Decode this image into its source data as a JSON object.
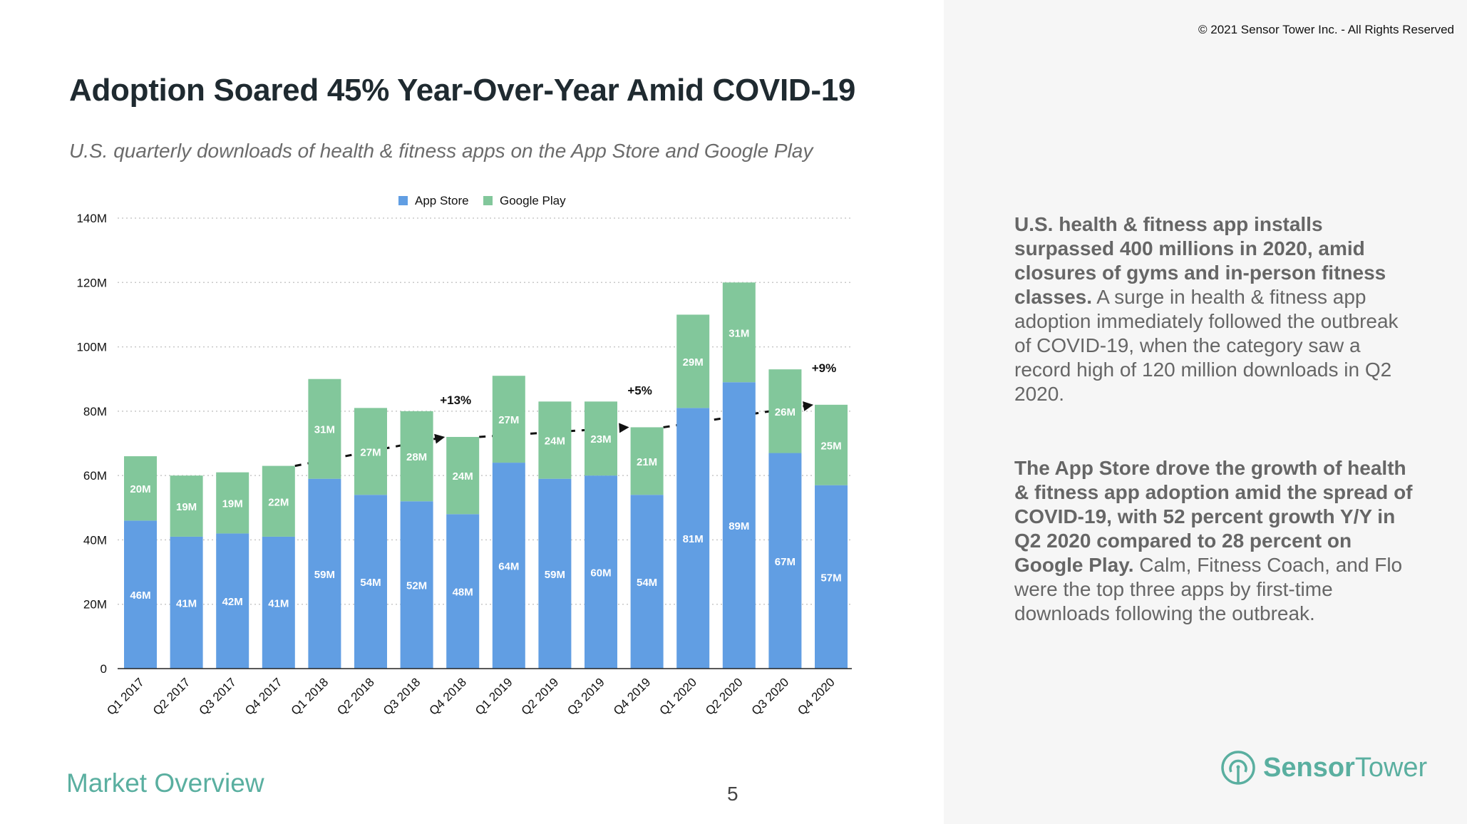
{
  "copyright": "© 2021 Sensor Tower Inc. - All Rights Reserved",
  "title": "Adoption Soared 45% Year-Over-Year Amid COVID-19",
  "subtitle": "U.S. quarterly downloads of health & fitness apps on the App Store and Google Play",
  "footer": {
    "section": "Market Overview",
    "page_number": "5"
  },
  "logo": {
    "icon": "sensor-tower-antenna-icon",
    "name_bold": "Sensor",
    "name_regular": "Tower"
  },
  "paragraphs": [
    {
      "bold": "U.S. health & fitness app installs surpassed 400 millions in 2020, amid closures of gyms and in-person fitness classes.",
      "regular": " A surge in health & fitness app adoption immediately followed the outbreak of COVID-19, when the category saw a record high of 120 million downloads in Q2 2020."
    },
    {
      "bold": "The App Store drove the growth of health & fitness app adoption amid the spread of COVID-19, with 52 percent growth Y/Y in Q2 2020 compared to 28 percent on Google Play.",
      "regular": " Calm, Fitness Coach, and Flo were the top three apps by first-time downloads following the outbreak."
    }
  ],
  "colors": {
    "app_store": "#619ee3",
    "google_play": "#82c79b",
    "accent": "#5aafa0"
  },
  "chart_data": {
    "type": "bar",
    "stacked": true,
    "title": "",
    "xlabel": "",
    "ylabel": "",
    "ylim": [
      0,
      140
    ],
    "yticks": [
      0,
      20,
      40,
      60,
      80,
      100,
      120,
      140
    ],
    "ytick_labels": [
      "0",
      "20M",
      "40M",
      "60M",
      "80M",
      "100M",
      "120M",
      "140M"
    ],
    "grid": true,
    "legend_position": "top-center",
    "categories": [
      "Q1 2017",
      "Q2 2017",
      "Q3 2017",
      "Q4 2017",
      "Q1 2018",
      "Q2 2018",
      "Q3 2018",
      "Q4 2018",
      "Q1 2019",
      "Q2 2019",
      "Q3 2019",
      "Q4 2019",
      "Q1 2020",
      "Q2 2020",
      "Q3 2020",
      "Q4 2020"
    ],
    "series": [
      {
        "name": "App Store",
        "color": "#619ee3",
        "values": [
          46,
          41,
          42,
          41,
          59,
          54,
          52,
          48,
          64,
          59,
          60,
          54,
          81,
          89,
          67,
          57
        ],
        "labels": [
          "46M",
          "41M",
          "42M",
          "41M",
          "59M",
          "54M",
          "52M",
          "48M",
          "64M",
          "59M",
          "60M",
          "54M",
          "81M",
          "89M",
          "67M",
          "57M"
        ]
      },
      {
        "name": "Google Play",
        "color": "#82c79b",
        "values": [
          20,
          19,
          19,
          22,
          31,
          27,
          28,
          24,
          27,
          24,
          23,
          21,
          29,
          31,
          26,
          25
        ],
        "labels": [
          "20M",
          "19M",
          "19M",
          "22M",
          "31M",
          "27M",
          "28M",
          "24M",
          "27M",
          "24M",
          "23M",
          "21M",
          "29M",
          "31M",
          "26M",
          "25M"
        ]
      }
    ],
    "annotations": [
      {
        "from": "Q4 2017",
        "to": "Q4 2018",
        "text": "+13%"
      },
      {
        "from": "Q4 2018",
        "to": "Q4 2019",
        "text": "+5%"
      },
      {
        "from": "Q4 2019",
        "to": "Q4 2020",
        "text": "+9%"
      }
    ]
  }
}
